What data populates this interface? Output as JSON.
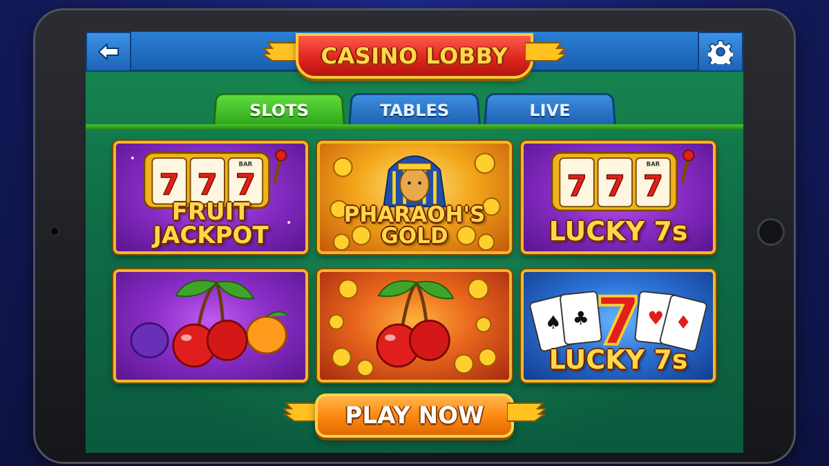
{
  "header": {
    "title": "CASINO LOBBY",
    "back_icon": "back-arrow-icon",
    "settings_icon": "gear-icon"
  },
  "tabs": [
    {
      "label": "SLOTS",
      "active": true
    },
    {
      "label": "TABLES",
      "active": false
    },
    {
      "label": "LIVE",
      "active": false
    }
  ],
  "games": [
    {
      "line1": "FRUIT",
      "line2": "JACKPOT",
      "theme": "slot-machine-777",
      "bar_label": "BAR"
    },
    {
      "line1": "PHARAOH'S",
      "line2": "GOLD",
      "theme": "pharaoh-gold-coins"
    },
    {
      "line1": "LUCKY 7s",
      "theme": "slot-machine-777",
      "bar_label": "BAR"
    },
    {
      "theme": "fruit-cherries-plum-orange"
    },
    {
      "theme": "cherries-gold-coins"
    },
    {
      "line1": "LUCKY 7s",
      "theme": "playing-cards-seven"
    }
  ],
  "play_button": {
    "label": "PLAY NOW"
  },
  "colors": {
    "accent_gold": "#ffd84a",
    "tab_active": "#2ea61b",
    "tab_inactive": "#1e5fb0",
    "banner_red": "#e0261f",
    "play_orange": "#ff8a12"
  }
}
